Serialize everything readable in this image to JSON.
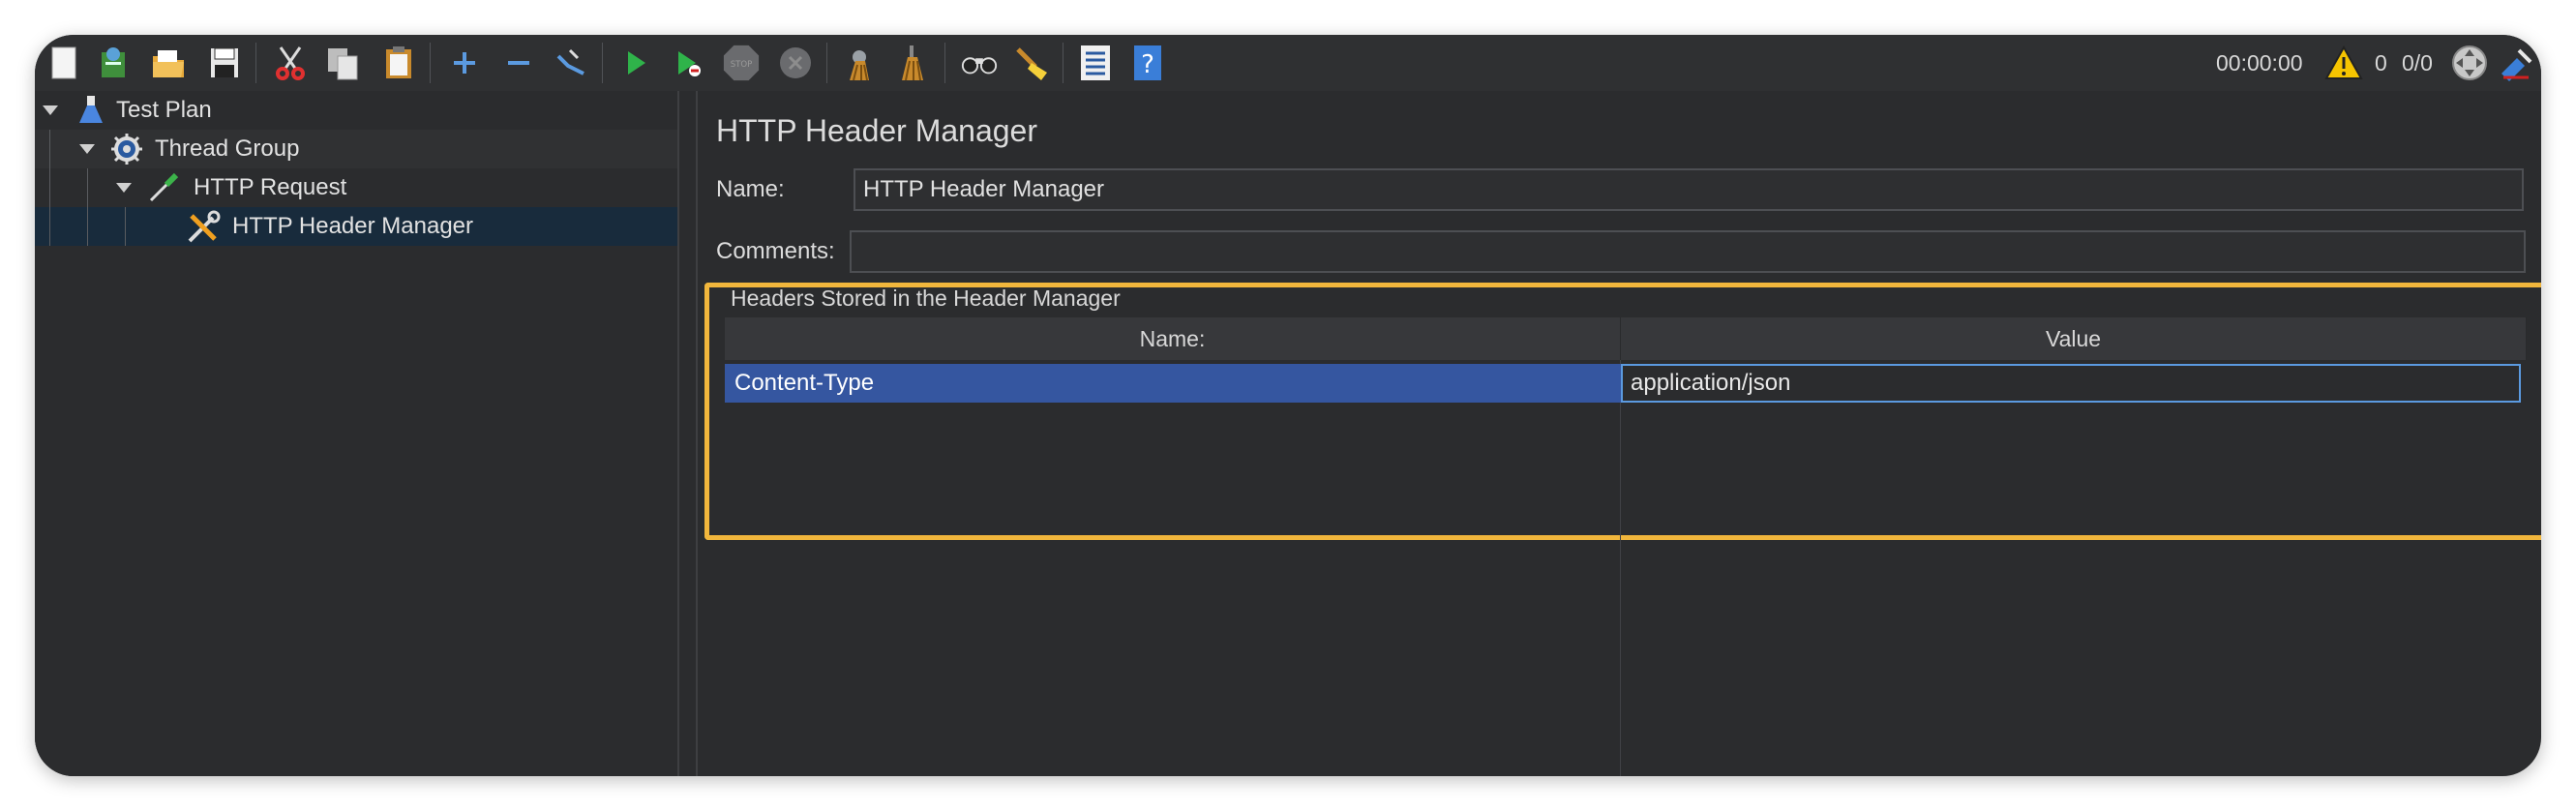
{
  "toolbar": {
    "icons": [
      "new-icon",
      "templates-icon",
      "open-icon",
      "save-icon",
      "cut-icon",
      "copy-icon",
      "paste-icon",
      "expand-icon",
      "collapse-icon",
      "toggle-icon",
      "start-icon",
      "start-no-pause-icon",
      "stop-icon",
      "shutdown-icon",
      "clear-icon",
      "clear-all-icon",
      "search-icon",
      "reset-search-icon",
      "function-helper-icon",
      "help-icon"
    ],
    "timer": "00:00:00",
    "warning_count": "0",
    "threads": "0/0"
  },
  "tree": {
    "items": [
      {
        "label": "Test Plan",
        "icon": "flask-icon"
      },
      {
        "label": "Thread Group",
        "icon": "gear-icon"
      },
      {
        "label": "HTTP Request",
        "icon": "pipette-icon"
      },
      {
        "label": "HTTP Header Manager",
        "icon": "tools-icon"
      }
    ]
  },
  "panel": {
    "title": "HTTP Header Manager",
    "name_label": "Name:",
    "name_value": "HTTP Header Manager",
    "comments_label": "Comments:",
    "comments_value": "",
    "group_title": "Headers Stored in the Header Manager",
    "table": {
      "headers": [
        "Name:",
        "Value"
      ],
      "rows": [
        {
          "name": "Content-Type",
          "value": "application/json"
        }
      ]
    }
  },
  "colors": {
    "background": "#2b2c2e",
    "selection": "#3556a0",
    "highlight": "#f1b63c",
    "edit_border": "#5b9ae0"
  }
}
